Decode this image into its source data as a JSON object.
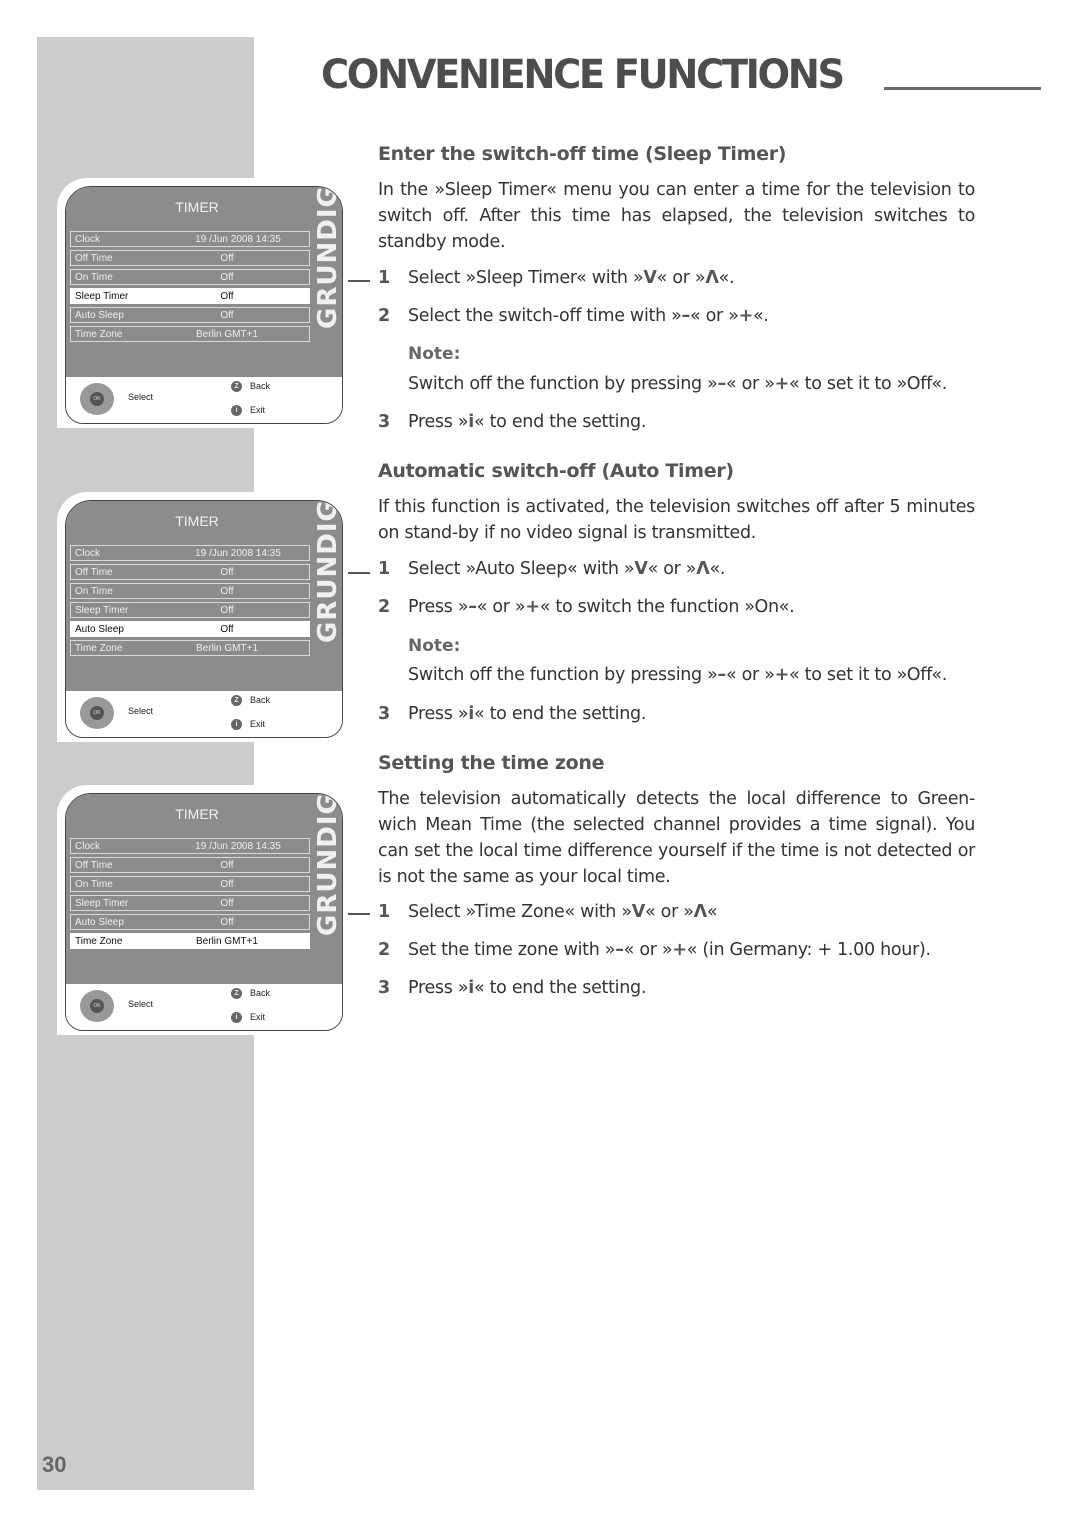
{
  "header": {
    "title": "CONVENIENCE FUNCTIONS",
    "page_number": "30"
  },
  "screens": [
    {
      "title": "TIMER",
      "brand": "GRUNDIG",
      "selected_index": 3,
      "rows": [
        {
          "label": "Clock",
          "value": "19 /Jun 2008 14:35"
        },
        {
          "label": "Off Time",
          "value": "Off"
        },
        {
          "label": "On Time",
          "value": "Off"
        },
        {
          "label": "Sleep Timer",
          "value": "Off"
        },
        {
          "label": "Auto Sleep",
          "value": "Off"
        },
        {
          "label": "Time Zone",
          "value": "Berlin GMT+1"
        }
      ],
      "footer": {
        "ok": "OK",
        "select": "Select",
        "back_key": "Z",
        "back": "Back",
        "exit_key": "i",
        "exit": "Exit"
      }
    },
    {
      "title": "TIMER",
      "brand": "GRUNDIG",
      "selected_index": 4,
      "rows": [
        {
          "label": "Clock",
          "value": "19 /Jun 2008 14:35"
        },
        {
          "label": "Off Time",
          "value": "Off"
        },
        {
          "label": "On Time",
          "value": "Off"
        },
        {
          "label": "Sleep Timer",
          "value": "Off"
        },
        {
          "label": "Auto Sleep",
          "value": "Off"
        },
        {
          "label": "Time Zone",
          "value": "Berlin GMT+1"
        }
      ],
      "footer": {
        "ok": "OK",
        "select": "Select",
        "back_key": "Z",
        "back": "Back",
        "exit_key": "i",
        "exit": "Exit"
      }
    },
    {
      "title": "TIMER",
      "brand": "GRUNDIG",
      "selected_index": 5,
      "rows": [
        {
          "label": "Clock",
          "value": "19 /Jun 2008 14:35"
        },
        {
          "label": "Off Time",
          "value": "Off"
        },
        {
          "label": "On Time",
          "value": "Off"
        },
        {
          "label": "Sleep Timer",
          "value": "Off"
        },
        {
          "label": "Auto Sleep",
          "value": "Off"
        },
        {
          "label": "Time Zone",
          "value": "Berlin GMT+1"
        }
      ],
      "footer": {
        "ok": "OK",
        "select": "Select",
        "back_key": "Z",
        "back": "Back",
        "exit_key": "i",
        "exit": "Exit"
      }
    }
  ],
  "sections": {
    "sleep": {
      "heading": "Enter the switch-off time (Sleep Timer)",
      "intro": "In the »Sleep Timer« menu you can enter a time for the television to switch off. After this time has elapsed, the television switches to standby mode.",
      "step1": {
        "num": "1",
        "a": "Select »Sleep Timer« with »",
        "k1": "V",
        "b": "« or »",
        "k2": "Λ",
        "c": "«."
      },
      "step2": {
        "num": "2",
        "a": "Select the switch-off time with »",
        "k1": "–",
        "b": "« or »",
        "k2": "+",
        "c": "«."
      },
      "note_label": "Note:",
      "note": {
        "a": "Switch off the function by pressing »",
        "k1": "–",
        "b": "« or »",
        "k2": "+",
        "c": "« to set it to »Off«."
      },
      "step3": {
        "num": "3",
        "a": "Press »",
        "k1": "i",
        "b": "« to end the setting."
      }
    },
    "auto": {
      "heading": "Automatic switch-off (Auto Timer)",
      "intro": "If this function is activated, the television switches off after 5 minutes on stand-by if no video signal is transmitted.",
      "step1": {
        "num": "1",
        "a": "Select »Auto Sleep« with »",
        "k1": "V",
        "b": "« or »",
        "k2": "Λ",
        "c": "«."
      },
      "step2": {
        "num": "2",
        "a": "Press »",
        "k1": "–",
        "b": "« or »",
        "k2": "+",
        "c": "« to switch the function »On«."
      },
      "note_label": "Note:",
      "note": {
        "a": "Switch off the function by pressing »",
        "k1": "–",
        "b": "« or »",
        "k2": "+",
        "c": "« to set it to »Off«."
      },
      "step3": {
        "num": "3",
        "a": "Press »",
        "k1": "i",
        "b": "« to end the setting."
      }
    },
    "tz": {
      "heading": "Setting the time zone",
      "intro": "The television automatically detects the local difference to Green-wich Mean Time (the selected channel provides a time signal). You can set the local time difference yourself if the time is not detected or is not the same as your local time.",
      "step1": {
        "num": "1",
        "a": "Select »Time Zone« with »",
        "k1": "V",
        "b": "« or »",
        "k2": "Λ",
        "c": "«"
      },
      "step2": {
        "num": "2",
        "a": "Set the time zone with »",
        "k1": "–",
        "b": "« or »",
        "k2": "+",
        "c": "« (in Germany: + 1.00 hour)."
      },
      "step3": {
        "num": "3",
        "a": "Press »",
        "k1": "i",
        "b": "« to end the setting."
      }
    }
  }
}
